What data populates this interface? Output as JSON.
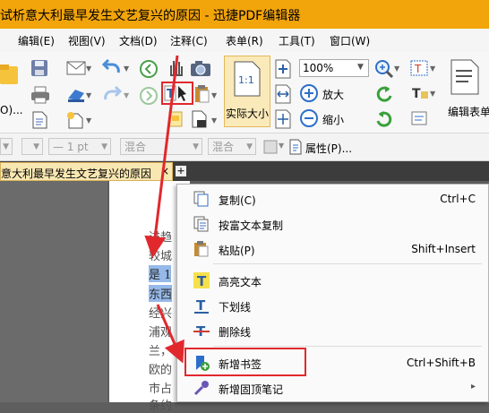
{
  "window": {
    "title": "试析意大利最早发生文艺复兴的原因 - 迅捷PDF编辑器"
  },
  "menubar": {
    "items": [
      "编辑(E)",
      "视图(V)",
      "文档(D)",
      "注释(C)",
      "表单(R)",
      "工具(T)",
      "窗口(W)"
    ]
  },
  "toolbar": {
    "partial_left_label": "O)...",
    "actual_size_label": "实际大小",
    "actual_size_icon_text": "1:1",
    "zoom_value": "100%",
    "zoom_in_label": "放大",
    "zoom_out_label": "缩小",
    "edit_form_label": "编辑表单"
  },
  "format_bar": {
    "line_width": "— 1 pt",
    "blend1": "混合",
    "blend2": "混合",
    "properties_label": "属性(P)..."
  },
  "tabs": {
    "doc_tab_label": "意大利最早发生文艺复兴的原因",
    "close_glyph": "×",
    "add_glyph": "+"
  },
  "document": {
    "lines": [
      "进趋",
      "较城",
      "是 1",
      "东西",
      "经兴",
      "浦观",
      "兰，",
      "欧的",
      "市占",
      "条约"
    ]
  },
  "context_menu": {
    "items": [
      {
        "label": "复制(C)",
        "shortcut": "Ctrl+C",
        "icon": "copy-icon"
      },
      {
        "label": "按富文本复制",
        "shortcut": "",
        "icon": "rich-text-copy-icon"
      },
      {
        "label": "粘贴(P)",
        "shortcut": "Shift+Insert",
        "icon": "paste-icon"
      },
      {
        "label": "高亮文本",
        "shortcut": "",
        "icon": "highlight-icon"
      },
      {
        "label": "下划线",
        "shortcut": "",
        "icon": "underline-icon"
      },
      {
        "label": "删除线",
        "shortcut": "",
        "icon": "strikethrough-icon"
      },
      {
        "label": "新增书签",
        "shortcut": "Ctrl+Shift+B",
        "icon": "bookmark-add-icon"
      },
      {
        "label": "新增固顶笔记",
        "shortcut": "",
        "icon": "pin-note-icon"
      }
    ],
    "submenu_glyph": "▸"
  },
  "colors": {
    "title_bar": "#f2a40b",
    "highlight": "#95b9e9",
    "annotation_red": "#e1282d"
  }
}
